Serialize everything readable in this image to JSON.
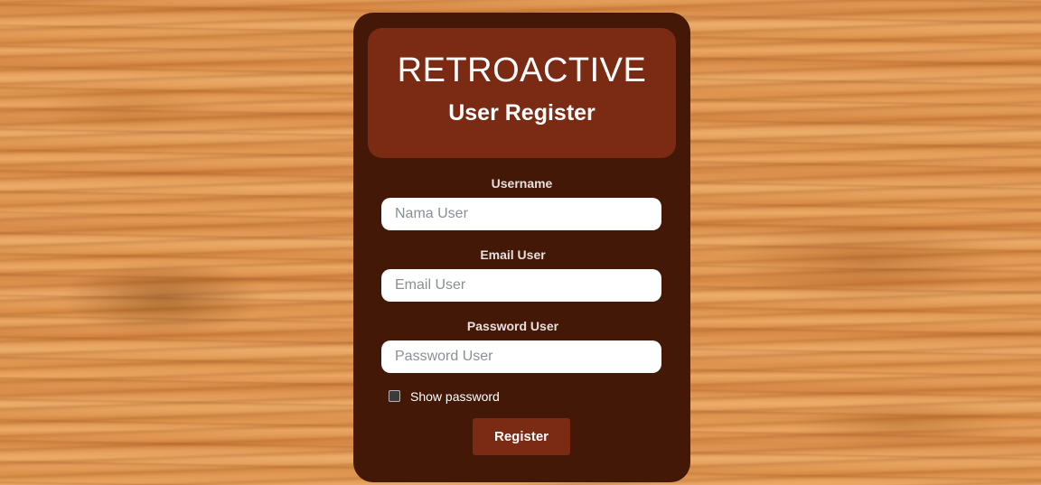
{
  "header": {
    "brand": "RETROACTIVE",
    "title": "User Register"
  },
  "form": {
    "username": {
      "label": "Username",
      "placeholder": "Nama User",
      "value": ""
    },
    "email": {
      "label": "Email User",
      "placeholder": "Email User",
      "value": ""
    },
    "password": {
      "label": "Password User",
      "placeholder": "Password User",
      "value": ""
    },
    "show_password": {
      "label": "Show password",
      "checked": false
    },
    "submit_label": "Register"
  },
  "colors": {
    "card_background": "#431806",
    "header_background": "#7b2a14",
    "button_background": "#7b2a14",
    "page_background": "#e0954f"
  }
}
